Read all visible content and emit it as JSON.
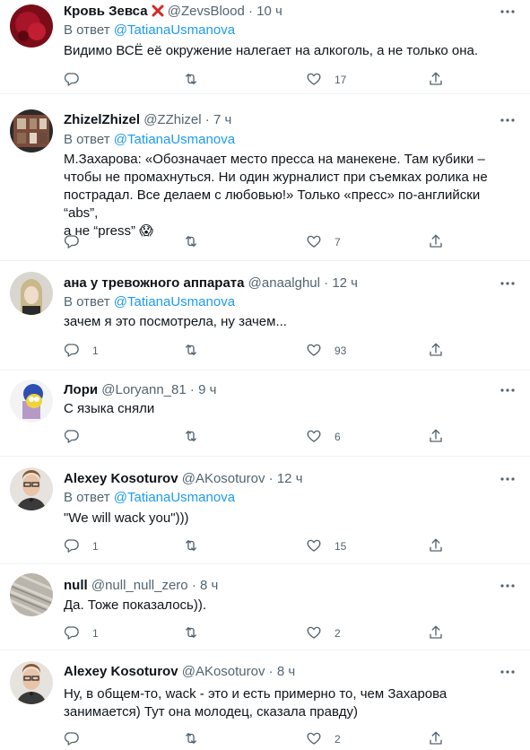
{
  "reply_prefix": "В ответ",
  "more_glyph": "···",
  "dot": "·",
  "colors": {
    "accent": "#1d9bf0",
    "muted": "#536471",
    "text": "#0f1419",
    "divider": "#eff3f4",
    "x_emoji": "#d62828"
  },
  "tweets": [
    {
      "name": "Кровь Зевса",
      "handle": "@ZevsBlood",
      "time": "10 ч",
      "reply_to": "@TatianaUsmanova",
      "lines": [
        "Видимо ВСЁ её окружение налегает на алкоголь, а не только она."
      ],
      "replies": "",
      "likes": "17"
    },
    {
      "name": "ZhizelZhizel",
      "handle": "@ZZhizel",
      "time": "7 ч",
      "reply_to": "@TatianaUsmanova",
      "lines": [
        "М.Захарова: «Обозначает место пресса на манекене. Там кубики –",
        "чтобы не промахнуться. Ни один журналист при съемках ролика не",
        "пострадал. Все делаем с любовью!» Только «пресс» по-английски “abs”,",
        "а не “press” 😱"
      ],
      "replies": "",
      "likes": "7"
    },
    {
      "name": "ана у тревожного аппарата",
      "handle": "@anaalghul",
      "time": "12 ч",
      "reply_to": "@TatianaUsmanova",
      "lines": [
        "зачем я это посмотрела, ну зачем..."
      ],
      "replies": "1",
      "likes": "93"
    },
    {
      "name": "Лори",
      "handle": "@Loryann_81",
      "time": "9 ч",
      "reply_to": "",
      "lines": [
        "С языка сняли"
      ],
      "replies": "",
      "likes": "6"
    },
    {
      "name": "Alexey Kosoturov",
      "handle": "@AKosoturov",
      "time": "12 ч",
      "reply_to": "@TatianaUsmanova",
      "lines": [
        "\"We will wack you\")))"
      ],
      "replies": "1",
      "likes": "15"
    },
    {
      "name": "null",
      "handle": "@null_null_zero",
      "time": "8 ч",
      "reply_to": "",
      "lines": [
        "Да. Тоже показалось))."
      ],
      "replies": "1",
      "likes": "2"
    },
    {
      "name": "Alexey Kosoturov",
      "handle": "@AKosoturov",
      "time": "8 ч",
      "reply_to": "",
      "lines": [
        "Ну, в общем-то, wack - это и есть примерно то, чем Захарова",
        "занимается) Тут она молодец, сказала правду)"
      ],
      "replies": "",
      "likes": "2"
    }
  ]
}
